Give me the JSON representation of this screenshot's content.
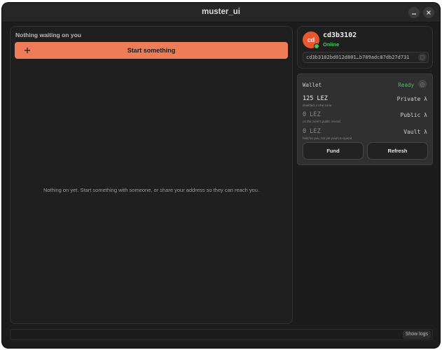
{
  "window": {
    "title": "muster_ui",
    "minimize_icon": "minimize-icon",
    "close_icon": "close-icon"
  },
  "main": {
    "heading": "Nothing waiting on you",
    "start_button_label": "Start something",
    "start_button_icon": "plus-icon",
    "empty_message": "Nothing on yet. Start something with someone, or share your address so they can reach you."
  },
  "identity": {
    "avatar_initials": "cd",
    "name": "cd3b3102",
    "status": "Online",
    "address": "cd3b3102bd012d801…b789adc87db27d731",
    "copy_icon": "copy-icon"
  },
  "wallet": {
    "label": "Wallet",
    "status": "Ready",
    "settings_icon": "gear-icon",
    "balances": [
      {
        "amount": "125 LEZ",
        "kind": "Private λ",
        "note": "shielded, in the zone"
      },
      {
        "amount": "0 LEZ",
        "kind": "Public λ",
        "note": "on the zone's public record"
      },
      {
        "amount": "0 LEZ",
        "kind": "Vault λ",
        "note": "held for you, not yet yours to spend"
      }
    ],
    "fund_label": "Fund",
    "refresh_label": "Refresh"
  },
  "footer": {
    "show_logs_label": "Show logs"
  },
  "colors": {
    "accent": "#ed7d58",
    "avatar": "#e8572e",
    "online": "#3ec95a",
    "background": "#1c1c1c"
  }
}
